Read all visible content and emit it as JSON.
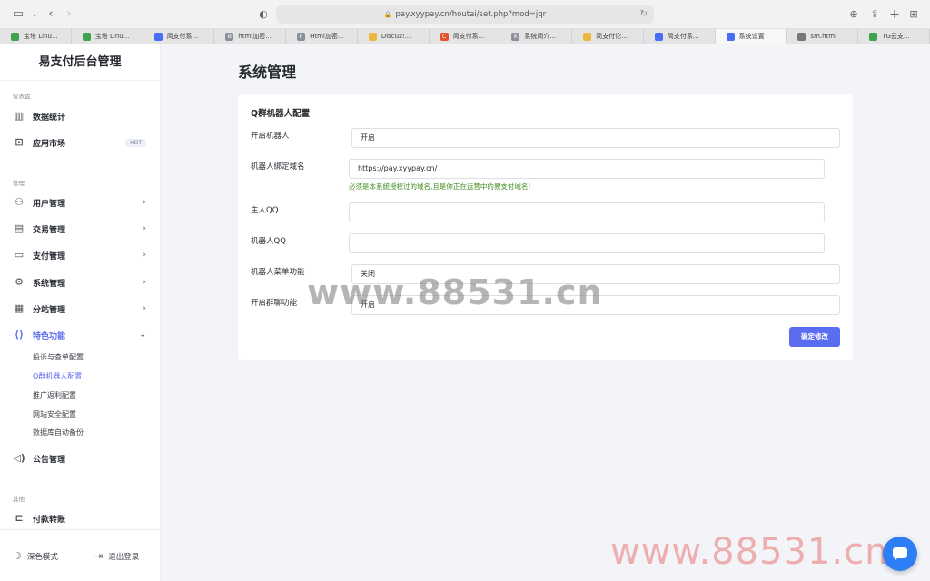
{
  "browser": {
    "url": "pay.xyypay.cn/houtai/set.php?mod=jqr",
    "tabs": [
      {
        "label": "宝塔 Linu...",
        "color": "#3fa34d",
        "glyph": "",
        "active": false
      },
      {
        "label": "宝塔 Linu...",
        "color": "#3fa34d",
        "glyph": "",
        "active": false
      },
      {
        "label": "简支付系...",
        "color": "#4a6cf7",
        "glyph": "",
        "active": false
      },
      {
        "label": "html加密...",
        "color": "#8a8f99",
        "glyph": "B",
        "active": false
      },
      {
        "label": "Html加密...",
        "color": "#8a8f99",
        "glyph": "F",
        "active": false
      },
      {
        "label": "Discuz!...",
        "color": "#e8b93a",
        "glyph": "",
        "active": false
      },
      {
        "label": "简支付系...",
        "color": "#e0532f",
        "glyph": "C",
        "active": false
      },
      {
        "label": "系统简介...",
        "color": "#8a8f99",
        "glyph": "K",
        "active": false
      },
      {
        "label": "简支付论...",
        "color": "#e8b93a",
        "glyph": "",
        "active": false
      },
      {
        "label": "简支付系...",
        "color": "#4a6cf7",
        "glyph": "",
        "active": false
      },
      {
        "label": "系统设置",
        "color": "#4a6cf7",
        "glyph": "",
        "active": true
      },
      {
        "label": "sm.html",
        "color": "#777777",
        "glyph": "",
        "active": false
      },
      {
        "label": "TG云支...",
        "color": "#3fa34d",
        "glyph": "",
        "active": false
      }
    ]
  },
  "sidebar": {
    "brand": "易支付后台管理",
    "groups": {
      "dashboard": "仪表盘",
      "manage": "管理",
      "other": "其他"
    },
    "items": {
      "stats": "数据统计",
      "market": "应用市场",
      "market_badge": "HOT",
      "users": "用户管理",
      "trade": "交易管理",
      "payment": "支付管理",
      "system": "系统管理",
      "substation": "分站管理",
      "features": "特色功能",
      "notice": "公告管理",
      "transfer": "付款转账"
    },
    "features_sub": [
      "投诉与查单配置",
      "Q群机器人配置",
      "推广返利配置",
      "网站安全配置",
      "数据库自动备份"
    ],
    "footer": {
      "dark_mode": "深色模式",
      "logout": "退出登录"
    }
  },
  "main": {
    "title": "系统管理",
    "card_title": "Q群机器人配置",
    "fields": {
      "enable_label": "开启机器人",
      "enable_value": "开启",
      "domain_label": "机器人绑定域名",
      "domain_value": "https://pay.xyypay.cn/",
      "domain_hint": "必须是本系统授权过的域名,且是你正在运营中的易支付域名!",
      "owner_label": "主人QQ",
      "owner_value": "",
      "robot_qq_label": "机器人QQ",
      "robot_qq_value": "",
      "menu_label": "机器人菜单功能",
      "menu_value": "关闭",
      "group_label": "开启群聊功能",
      "group_value": "开启"
    },
    "submit": "确定修改"
  },
  "watermarks": {
    "center": "www.88531.cn",
    "corner": "www.88531.cn"
  },
  "colors": {
    "accent": "#5a6cf0",
    "hint": "#3c8a1e",
    "chat": "#2d7ef7"
  }
}
